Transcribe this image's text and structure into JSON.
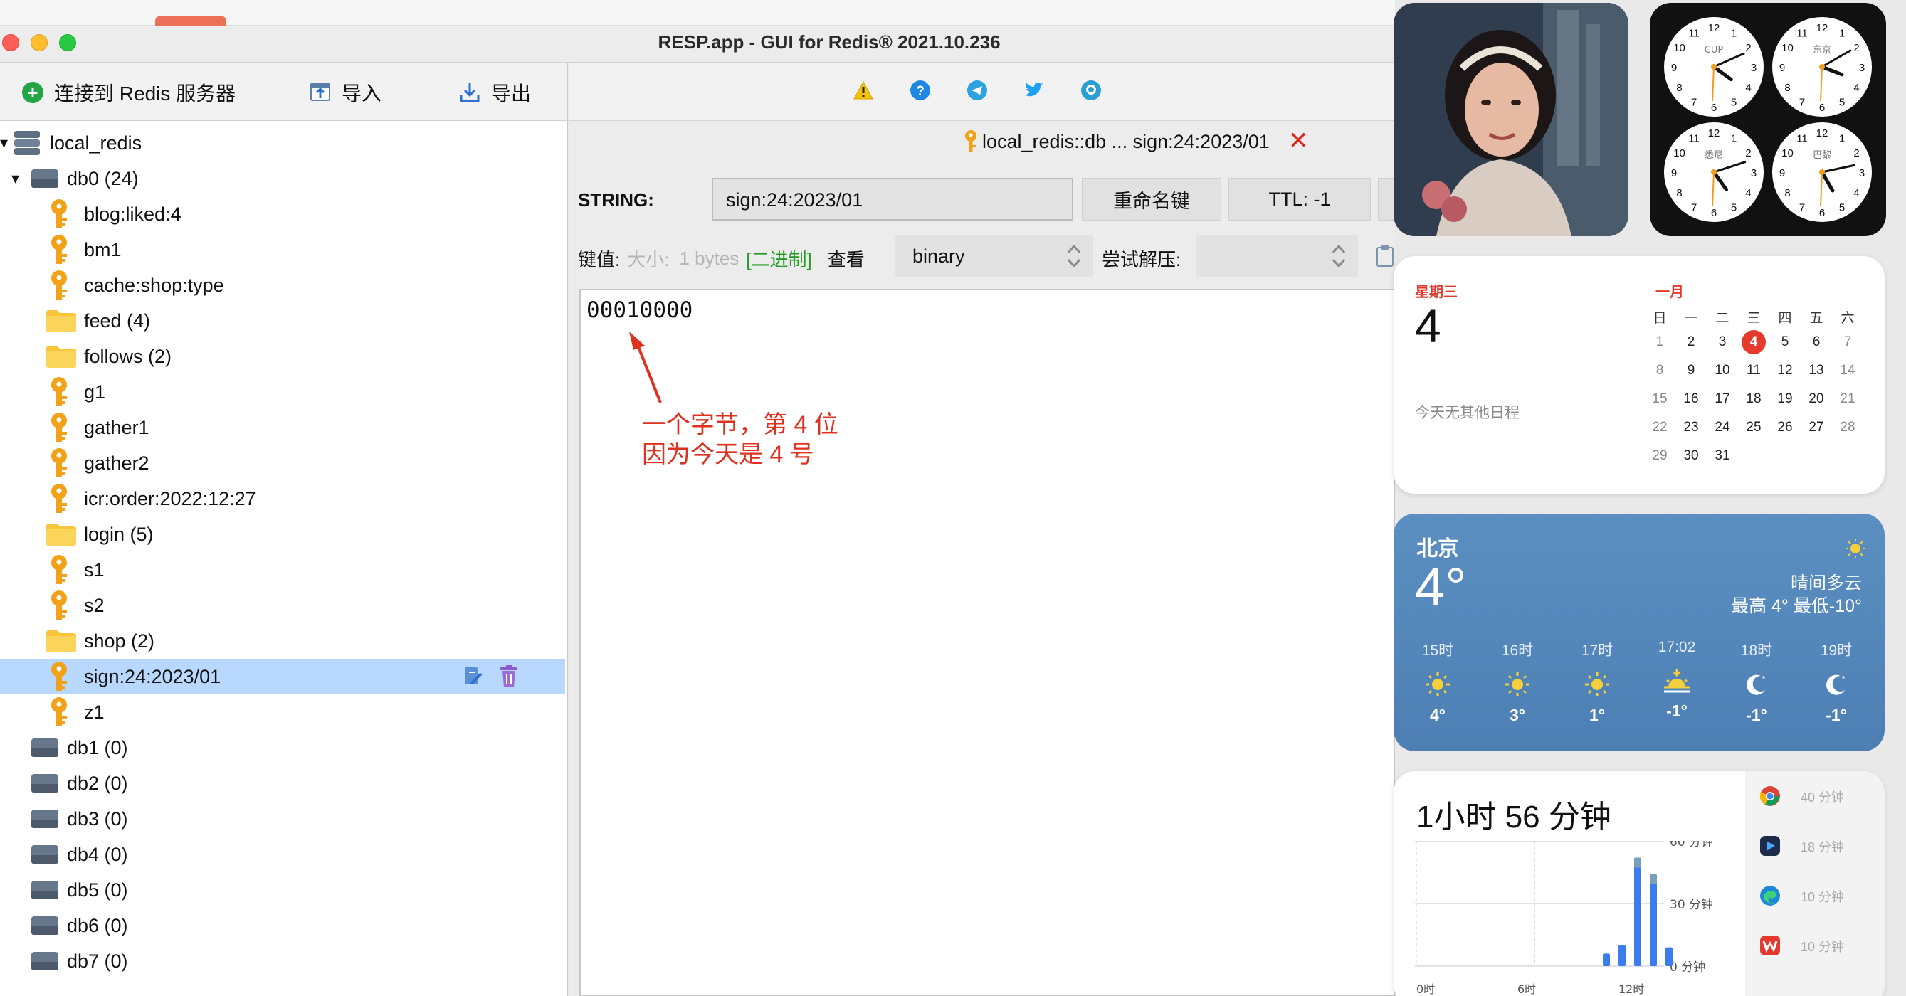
{
  "window": {
    "title": "RESP.app - GUI for Redis® 2021.10.236"
  },
  "left_toolbar": {
    "connect_label": "连接到 Redis 服务器",
    "import_label": "导入",
    "export_label": "导出"
  },
  "tree": {
    "server": "local_redis",
    "db0": {
      "name": "db0",
      "count": "(24)"
    },
    "items": [
      {
        "type": "key",
        "label": "blog:liked:4"
      },
      {
        "type": "key",
        "label": "bm1"
      },
      {
        "type": "key",
        "label": "cache:shop:type"
      },
      {
        "type": "folder",
        "label": "feed (4)"
      },
      {
        "type": "folder",
        "label": "follows (2)"
      },
      {
        "type": "key",
        "label": "g1"
      },
      {
        "type": "key",
        "label": "gather1"
      },
      {
        "type": "key",
        "label": "gather2"
      },
      {
        "type": "key",
        "label": "icr:order:2022:12:27"
      },
      {
        "type": "folder",
        "label": "login (5)"
      },
      {
        "type": "key",
        "label": "s1"
      },
      {
        "type": "key",
        "label": "s2"
      },
      {
        "type": "folder",
        "label": "shop (2)"
      },
      {
        "type": "key",
        "label": "sign:24:2023/01",
        "selected": true
      },
      {
        "type": "key",
        "label": "z1"
      }
    ],
    "dbs": [
      {
        "name": "db1",
        "count": "(0)"
      },
      {
        "name": "db2",
        "count": "(0)"
      },
      {
        "name": "db3",
        "count": "(0)"
      },
      {
        "name": "db4",
        "count": "(0)"
      },
      {
        "name": "db5",
        "count": "(0)"
      },
      {
        "name": "db6",
        "count": "(0)"
      },
      {
        "name": "db7",
        "count": "(0)"
      }
    ]
  },
  "tab": {
    "label": "local_redis::db ... sign:24:2023/01"
  },
  "key_view": {
    "type_label": "STRING:",
    "key_name": "sign:24:2023/01",
    "rename_label": "重命名键",
    "ttl_label": "TTL:  -1",
    "value_label": "键值:",
    "size_label": "大小:",
    "size_value": "1 bytes",
    "binary_tag": "[二进制]",
    "view_label": "查看",
    "view_mode": "binary",
    "decompress_label": "尝试解压:",
    "decompress_value": "",
    "value": "00010000",
    "annotation_line1": "一个字节，第 4 位",
    "annotation_line2": "因为今天是 4 号"
  },
  "calendar": {
    "weekday": "星期三",
    "day": "4",
    "no_events": "今天无其他日程",
    "month": "一月",
    "week_header": [
      "日",
      "一",
      "二",
      "三",
      "四",
      "五",
      "六"
    ],
    "weeks": [
      [
        "1",
        "2",
        "3",
        "4",
        "5",
        "6",
        "7"
      ],
      [
        "8",
        "9",
        "10",
        "11",
        "12",
        "13",
        "14"
      ],
      [
        "15",
        "16",
        "17",
        "18",
        "19",
        "20",
        "21"
      ],
      [
        "22",
        "23",
        "24",
        "25",
        "26",
        "27",
        "28"
      ],
      [
        "29",
        "30",
        "31",
        "",
        "",
        "",
        ""
      ]
    ],
    "today": "4"
  },
  "weather": {
    "city": "北京",
    "temp": "4°",
    "condition": "晴间多云",
    "range": "最高 4° 最低-10°",
    "hours": [
      {
        "time": "15时",
        "icon": "sun-icon",
        "temp": "4°"
      },
      {
        "time": "16时",
        "icon": "sun-icon",
        "temp": "3°"
      },
      {
        "time": "17时",
        "icon": "sun-icon",
        "temp": "1°"
      },
      {
        "time": "17:02",
        "icon": "sunset-icon",
        "temp": "-1°"
      },
      {
        "time": "18时",
        "icon": "moon-icon",
        "temp": "-1°"
      },
      {
        "time": "19时",
        "icon": "moon-icon",
        "temp": "-1°"
      }
    ]
  },
  "clocks": [
    {
      "city": "CUP",
      "hour": 4.2,
      "minute": 11
    },
    {
      "city": "东京",
      "hour": 3.7,
      "minute": 10
    },
    {
      "city": "悉尼",
      "hour": 4.8,
      "minute": 12
    },
    {
      "city": "巴黎",
      "hour": 5.0,
      "minute": 13
    }
  ],
  "screen_time": {
    "total": "1小时 56 分钟",
    "y_labels": [
      "60 分钟",
      "30 分钟",
      "0 分钟"
    ],
    "x_labels": [
      "0时",
      "6时",
      "12时"
    ],
    "apps": [
      {
        "icon": "chrome-icon",
        "time": "40 分钟"
      },
      {
        "icon": "video-app-icon",
        "time": "18 分钟"
      },
      {
        "icon": "edge-icon",
        "time": "10 分钟"
      },
      {
        "icon": "wps-icon",
        "time": "10 分钟"
      }
    ],
    "chart_data": {
      "type": "bar",
      "x": [
        "10时",
        "11时",
        "12时",
        "13时",
        "14时"
      ],
      "values": [
        6,
        10,
        52,
        44,
        9
      ],
      "ylim": [
        0,
        60
      ],
      "colors": {
        "bar": "#3b7ded",
        "cap": "#7a9fb8"
      }
    }
  },
  "colors": {
    "accent_red": "#e2231a",
    "selection": "#b8d8ff",
    "key_orange": "#f2a218",
    "folder_yellow": "#f8c63b"
  }
}
